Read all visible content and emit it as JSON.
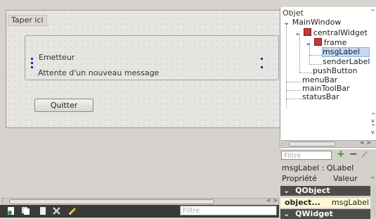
{
  "form": {
    "menu_placeholder": "Taper ici",
    "sender_label": "Emetteur",
    "message_label": "Attente d'un nouveau message",
    "quit_button": "Quitter"
  },
  "bottom": {
    "filter_placeholder": "Filtre"
  },
  "object_inspector": {
    "title": "Objet",
    "items": [
      {
        "label": "MainWindow"
      },
      {
        "label": "centralWidget"
      },
      {
        "label": "frame"
      },
      {
        "label": "msgLabel",
        "selected": true
      },
      {
        "label": "senderLabel"
      },
      {
        "label": "pushButton"
      },
      {
        "label": "menuBar"
      },
      {
        "label": "mainToolBar"
      },
      {
        "label": "statusBar"
      }
    ]
  },
  "property_editor": {
    "filter_placeholder": "Filtre",
    "class_label": "msgLabel : QLabel",
    "col_property": "Propriété",
    "col_value": "Valeur",
    "sections": [
      "QObject",
      "QWidget"
    ],
    "rows": [
      {
        "name": "object...",
        "value": "msgLabel"
      }
    ]
  },
  "colors": {
    "accent": "#c4d7f0",
    "toolbar_bg": "#3a3a3a",
    "section_bg": "#4e4c48"
  }
}
